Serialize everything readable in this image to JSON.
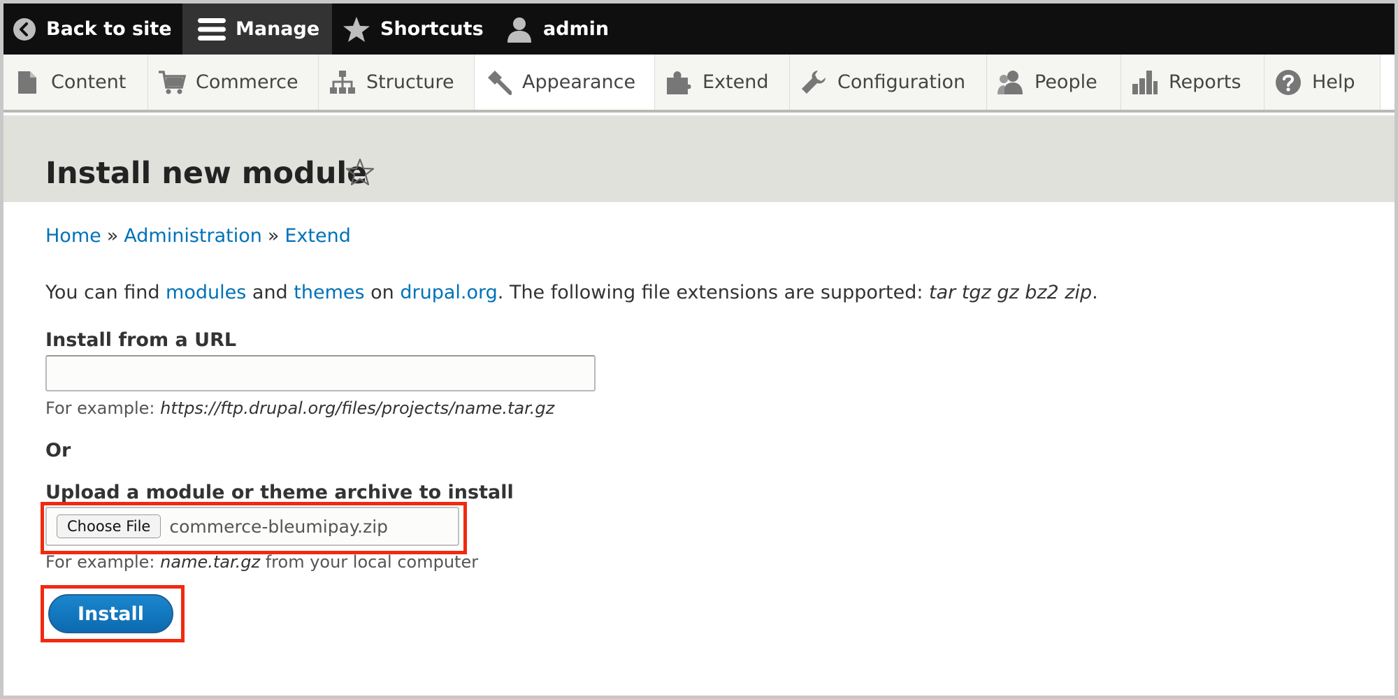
{
  "toolbar": {
    "back_label": "Back to site",
    "manage_label": "Manage",
    "shortcuts_label": "Shortcuts",
    "user_label": "admin"
  },
  "tray": {
    "items": [
      {
        "label": "Content",
        "icon": "content-icon"
      },
      {
        "label": "Commerce",
        "icon": "commerce-cart-icon"
      },
      {
        "label": "Structure",
        "icon": "structure-icon"
      },
      {
        "label": "Appearance",
        "icon": "appearance-brush-icon"
      },
      {
        "label": "Extend",
        "icon": "extend-puzzle-icon"
      },
      {
        "label": "Configuration",
        "icon": "wrench-icon"
      },
      {
        "label": "People",
        "icon": "people-icon"
      },
      {
        "label": "Reports",
        "icon": "reports-bars-icon"
      },
      {
        "label": "Help",
        "icon": "help-icon"
      }
    ]
  },
  "page": {
    "title": "Install new module"
  },
  "breadcrumb": {
    "items": [
      "Home",
      "Administration",
      "Extend"
    ],
    "separator": "»"
  },
  "intro": {
    "prefix": "You can find ",
    "modules_link": "modules",
    "and": " and ",
    "themes_link": "themes",
    "on": " on ",
    "drupal_link": "drupal.org",
    "suffix": ". The following file extensions are supported: ",
    "extensions": "tar tgz gz bz2 zip",
    "end": "."
  },
  "url_field": {
    "label": "Install from a URL",
    "value": "",
    "hint_prefix": "For example: ",
    "hint_example": "https://ftp.drupal.org/files/projects/name.tar.gz"
  },
  "or_label": "Or",
  "upload_field": {
    "label": "Upload a module or theme archive to install",
    "button_label": "Choose File",
    "file_name": "commerce-bleumipay.zip",
    "hint_prefix": "For example: ",
    "hint_example": "name.tar.gz",
    "hint_suffix": " from your local computer"
  },
  "install_button": "Install",
  "colors": {
    "link": "#0071b8",
    "toolbar_bg": "#0f0f0f",
    "highlight": "#f02a10",
    "primary_button": "#0c6ab0"
  }
}
